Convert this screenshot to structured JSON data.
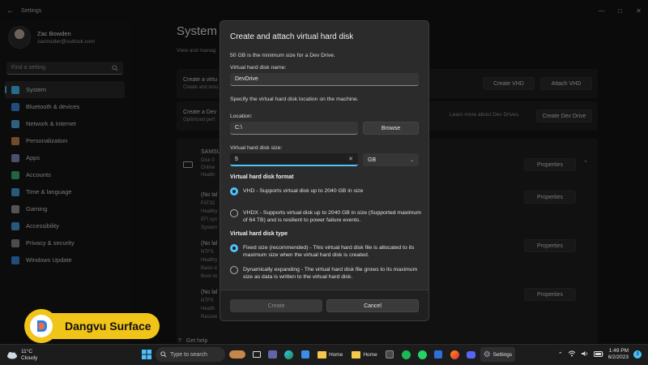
{
  "window": {
    "title": "Settings",
    "controls": [
      "—",
      "□",
      "✕"
    ]
  },
  "profile": {
    "name": "Zac Bowden",
    "email": "zacinsider@outlook.com"
  },
  "search": {
    "placeholder": "Find a setting"
  },
  "nav": [
    {
      "label": "System",
      "icon": "system-icon",
      "color": "#4cc2ff",
      "active": true
    },
    {
      "label": "Bluetooth & devices",
      "icon": "bluetooth-icon",
      "color": "#3a8ee6"
    },
    {
      "label": "Network & internet",
      "icon": "wifi-icon",
      "color": "#5ab0e8"
    },
    {
      "label": "Personalization",
      "icon": "brush-icon",
      "color": "#d08a4a"
    },
    {
      "label": "Apps",
      "icon": "apps-icon",
      "color": "#8c8ccc"
    },
    {
      "label": "Accounts",
      "icon": "accounts-icon",
      "color": "#3cb57a"
    },
    {
      "label": "Time & language",
      "icon": "globe-icon",
      "color": "#4aa0e0"
    },
    {
      "label": "Gaming",
      "icon": "gaming-icon",
      "color": "#9a9a9a"
    },
    {
      "label": "Accessibility",
      "icon": "accessibility-icon",
      "color": "#4aa0e0"
    },
    {
      "label": "Privacy & security",
      "icon": "shield-icon",
      "color": "#8a8a8a"
    },
    {
      "label": "Windows Update",
      "icon": "update-icon",
      "color": "#3a8ee6"
    }
  ],
  "main": {
    "title": "System",
    "subtitle": "View and manag",
    "card1": {
      "title": "Create a virtu",
      "sub": "Create and mou",
      "btn1": "Create VHD",
      "btn2": "Attach VHD"
    },
    "card2": {
      "title": "Create a Dev",
      "sub": "Optimized perf",
      "link": "Learn more about Dev Drives.",
      "btn": "Create Dev Drive"
    },
    "disk": {
      "name": "SAMSU",
      "lines": [
        "Disk 0",
        "Online",
        "Health"
      ]
    },
    "volumes": [
      {
        "lines": [
          "(No lal",
          "FAT32",
          "Healthy",
          "EFI sys",
          "System"
        ],
        "btn": "Properties"
      },
      {
        "lines": [
          "(No lal",
          "NTFS",
          "Healthy",
          "Basic d",
          "Boot vo"
        ],
        "btn": "Properties"
      },
      {
        "lines": [
          "(No lal",
          "NTFS",
          "Health",
          "Recove"
        ],
        "btn": "Properties"
      }
    ],
    "disk_btn": "Properties",
    "help": "Get help"
  },
  "dialog": {
    "title": "Create and attach virtual hard disk",
    "min_note": "50 GB is the minimum size for a Dev Drive.",
    "name_label": "Virtual hard disk name:",
    "name_value": "DevDrive",
    "location_note": "Specify the virtual hard disk location on the machine.",
    "location_label": "Location:",
    "location_value": "C:\\",
    "browse": "Browse",
    "size_label": "Virtual hard disk size:",
    "size_value": "5",
    "clear": "✕",
    "unit": "GB",
    "format_heading": "Virtual hard disk format",
    "format_vhd": "VHD - Supports virtual disk up to 2040 GB in size",
    "format_vhdx": "VHDX - Supports virtual disk up to 2040 GB in size (Supported maximum of 64 TB) and is resilient to power failure events.",
    "type_heading": "Virtual hard disk type",
    "type_fixed": "Fixed size (recommended) - This virtual hard disk file is allocated to its maximum size when the virtual hard disk is created.",
    "type_dynamic": "Dynamically expanding - The virtual hard disk file grows to its maximum size as data is written to the virtual hard disk.",
    "create": "Create",
    "cancel": "Cancel"
  },
  "watermark": {
    "text": "Dangvu Surface"
  },
  "taskbar": {
    "weather_temp": "11°C",
    "weather_desc": "Cloudy",
    "search": "Type to search",
    "apps": [
      {
        "label": "Home",
        "icon": "folder-icon"
      },
      {
        "label": "Home",
        "icon": "folder-icon"
      },
      {
        "label": "Settings",
        "icon": "gear-icon"
      }
    ],
    "time": "1:49 PM",
    "date": "6/2/2023",
    "notifications": "3"
  },
  "colors": {
    "accent": "#4cc2ff",
    "watermark": "#f0c419"
  }
}
